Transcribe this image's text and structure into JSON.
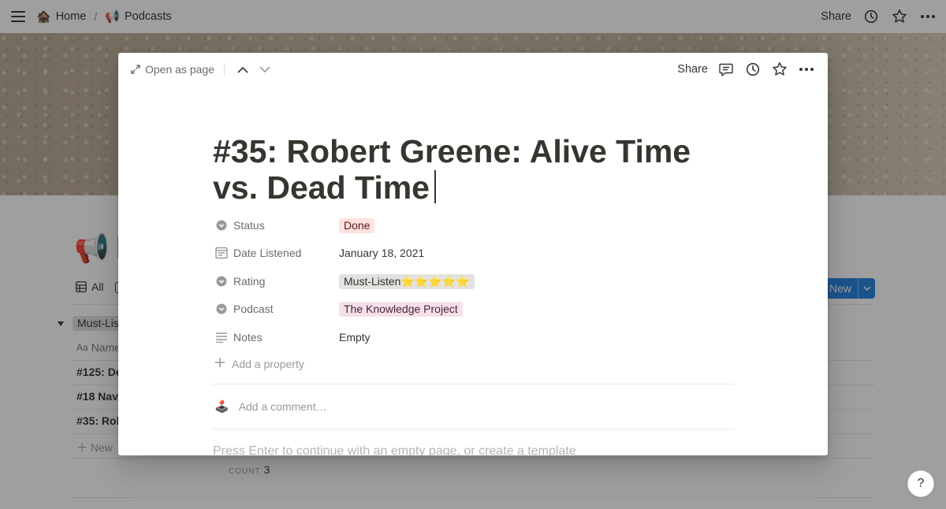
{
  "topbar": {
    "breadcrumb": [
      {
        "emoji": "🏚️",
        "label": "Home"
      },
      {
        "emoji": "📢",
        "label": "Podcasts"
      }
    ],
    "separator": "/",
    "share_label": "Share"
  },
  "background_page": {
    "title_emoji": "📢",
    "title_partial": "P",
    "view_label": "All",
    "new_button_label": "New",
    "group_tag": "Must-Lis",
    "name_column": "Name",
    "rows": [
      "#125: De",
      "#18 Nav",
      "#35: Rob"
    ],
    "new_row_label": "New",
    "count_label": "COUNT",
    "count_value": "3",
    "help_label": "?"
  },
  "modal": {
    "open_as_page_label": "Open as page",
    "share_label": "Share",
    "title": "#35: Robert Greene: Alive Time vs. Dead Time",
    "properties": [
      {
        "icon": "select-icon",
        "name": "Status",
        "value": "Done",
        "kind": "tag",
        "color": "#ffe2dd"
      },
      {
        "icon": "calendar-icon",
        "name": "Date Listened",
        "value": "January 18, 2021",
        "kind": "text"
      },
      {
        "icon": "select-icon",
        "name": "Rating",
        "value": "Must-Listen⭐⭐⭐⭐⭐",
        "kind": "tag",
        "color": "#e3e2e0"
      },
      {
        "icon": "select-icon",
        "name": "Podcast",
        "value": "The Knowledge Project",
        "kind": "tag",
        "color": "#f5e0e9"
      },
      {
        "icon": "text-icon",
        "name": "Notes",
        "value": "Empty",
        "kind": "empty"
      }
    ],
    "add_property_label": "Add a property",
    "comment_placeholder": "Add a comment…",
    "comment_avatar": "🕹️",
    "hint": "Press Enter to continue with an empty page, or create a template"
  },
  "colors": {
    "text": "#37352f",
    "accent": "#2383e2",
    "done_tag": "#ffe2dd",
    "rating_tag": "#e3e2e0",
    "podcast_tag": "#f5e0e9"
  }
}
